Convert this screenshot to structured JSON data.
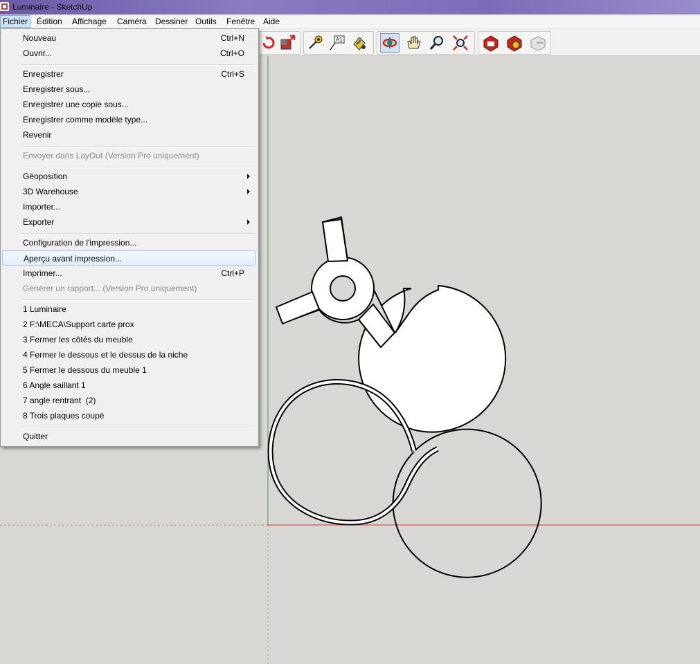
{
  "window": {
    "title": "Luminaire - SketchUp"
  },
  "menubar": {
    "items": [
      "Fichier",
      "Édition",
      "Affichage",
      "Caméra",
      "Dessiner",
      "Outils",
      "Fenêtre",
      "Aide"
    ],
    "active": "Fichier"
  },
  "toolbar": {
    "icons": [
      "rotate-icon",
      "scale-icon",
      "tape-measure-icon",
      "text-icon",
      "paint-bucket-icon",
      "orbit-icon",
      "pan-icon",
      "zoom-icon",
      "zoom-extents-icon",
      "warehouse-get-icon",
      "warehouse-share-icon",
      "share-component-icon"
    ],
    "pressed": "orbit-icon"
  },
  "file_menu": {
    "new": {
      "label": "Nouveau",
      "shortcut": "Ctrl+N"
    },
    "open": {
      "label": "Ouvrir...",
      "shortcut": "Ctrl+O"
    },
    "save": {
      "label": "Enregistrer",
      "shortcut": "Ctrl+S"
    },
    "save_as": {
      "label": "Enregistrer sous..."
    },
    "save_copy": {
      "label": "Enregistrer une copie sous..."
    },
    "save_template": {
      "label": "Enregistrer comme modèle type..."
    },
    "revert": {
      "label": "Revenir"
    },
    "send_layout": {
      "label": "Envoyer dans LayOut (Version Pro uniquement)"
    },
    "geolocation": {
      "label": "Géoposition"
    },
    "warehouse": {
      "label": "3D Warehouse"
    },
    "import": {
      "label": "Importer..."
    },
    "export": {
      "label": "Exporter"
    },
    "print_setup": {
      "label": "Configuration de l'impression..."
    },
    "print_preview": {
      "label": "Aperçu avant impression..."
    },
    "print": {
      "label": "Imprimer...",
      "shortcut": "Ctrl+P"
    },
    "report": {
      "label": "Générer un rapport... (Version Pro uniquement)"
    },
    "recent": [
      "1 Luminaire",
      "2 F:\\MECA\\Support carte prox",
      "3 Fermer les côtés du meuble",
      "4 Fermer le dessous et le dessus de la niche",
      "5 Fermer le dessous du meuble 1",
      "6 Angle saillant 1",
      "7 angle rentrant  (2)",
      "8 Trois plaques coupé"
    ],
    "quit": {
      "label": "Quitter"
    }
  },
  "colors": {
    "canvas": "#d8d7d3",
    "axis_green": "#3fa33f",
    "axis_red": "#d03a2a",
    "menu_highlight": "#cfe3f7"
  }
}
